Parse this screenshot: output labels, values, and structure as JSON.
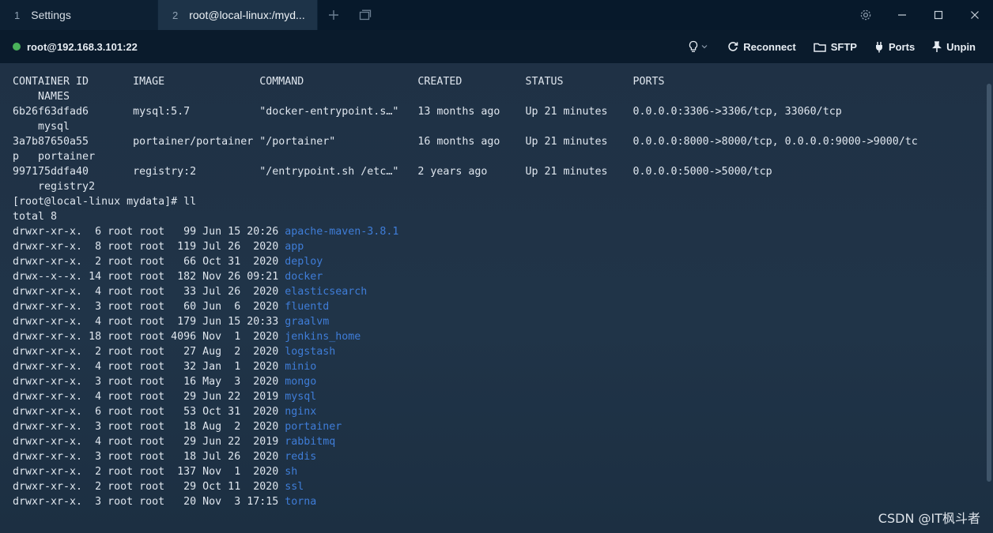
{
  "tabs": [
    {
      "number": "1",
      "title": "Settings"
    },
    {
      "number": "2",
      "title": "root@local-linux:/myd..."
    }
  ],
  "toolbar": {
    "host": "root@192.168.3.101:22",
    "reconnect_label": "Reconnect",
    "sftp_label": "SFTP",
    "ports_label": "Ports",
    "unpin_label": "Unpin"
  },
  "icons": {
    "new_tab": "plus-icon",
    "tab_layout": "tabs-layout-icon",
    "settings": "gear-icon",
    "minimize": "minimize-icon",
    "maximize": "maximize-icon",
    "close": "close-icon",
    "status": "status-dot",
    "bulb": "lightbulb-icon",
    "reconnect": "refresh-icon",
    "sftp": "folder-icon",
    "ports": "plug-icon",
    "unpin": "pin-icon"
  },
  "colors": {
    "status_connected": "#49b25a",
    "directory": "#3f7dd8",
    "text": "#dfe6ee"
  },
  "terminal": {
    "lines": [
      {
        "text": "CONTAINER ID       IMAGE               COMMAND                  CREATED          STATUS           PORTS"
      },
      {
        "text": "    NAMES"
      },
      {
        "text": "6b26f63dfad6       mysql:5.7           \"docker-entrypoint.s…\"   13 months ago    Up 21 minutes    0.0.0.0:3306->3306/tcp, 33060/tcp"
      },
      {
        "text": "    mysql"
      },
      {
        "text": "3a7b87650a55       portainer/portainer \"/portainer\"             16 months ago    Up 21 minutes    0.0.0.0:8000->8000/tcp, 0.0.0.0:9000->9000/tc"
      },
      {
        "text": "p   portainer"
      },
      {
        "text": "997175ddfa40       registry:2          \"/entrypoint.sh /etc…\"   2 years ago      Up 21 minutes    0.0.0.0:5000->5000/tcp"
      },
      {
        "text": "    registry2"
      },
      {
        "text": "[root@local-linux mydata]# ll"
      },
      {
        "text": "total 8"
      },
      {
        "text": "drwxr-xr-x.  6 root root   99 Jun 15 20:26 ",
        "dir": "apache-maven-3.8.1"
      },
      {
        "text": "drwxr-xr-x.  8 root root  119 Jul 26  2020 ",
        "dir": "app"
      },
      {
        "text": "drwxr-xr-x.  2 root root   66 Oct 31  2020 ",
        "dir": "deploy"
      },
      {
        "text": "drwx--x--x. 14 root root  182 Nov 26 09:21 ",
        "dir": "docker"
      },
      {
        "text": "drwxr-xr-x.  4 root root   33 Jul 26  2020 ",
        "dir": "elasticsearch"
      },
      {
        "text": "drwxr-xr-x.  3 root root   60 Jun  6  2020 ",
        "dir": "fluentd"
      },
      {
        "text": "drwxr-xr-x.  4 root root  179 Jun 15 20:33 ",
        "dir": "graalvm"
      },
      {
        "text": "drwxr-xr-x. 18 root root 4096 Nov  1  2020 ",
        "dir": "jenkins_home"
      },
      {
        "text": "drwxr-xr-x.  2 root root   27 Aug  2  2020 ",
        "dir": "logstash"
      },
      {
        "text": "drwxr-xr-x.  4 root root   32 Jan  1  2020 ",
        "dir": "minio"
      },
      {
        "text": "drwxr-xr-x.  3 root root   16 May  3  2020 ",
        "dir": "mongo"
      },
      {
        "text": "drwxr-xr-x.  4 root root   29 Jun 22  2019 ",
        "dir": "mysql"
      },
      {
        "text": "drwxr-xr-x.  6 root root   53 Oct 31  2020 ",
        "dir": "nginx"
      },
      {
        "text": "drwxr-xr-x.  3 root root   18 Aug  2  2020 ",
        "dir": "portainer"
      },
      {
        "text": "drwxr-xr-x.  4 root root   29 Jun 22  2019 ",
        "dir": "rabbitmq"
      },
      {
        "text": "drwxr-xr-x.  3 root root   18 Jul 26  2020 ",
        "dir": "redis"
      },
      {
        "text": "drwxr-xr-x.  2 root root  137 Nov  1  2020 ",
        "dir": "sh"
      },
      {
        "text": "drwxr-xr-x.  2 root root   29 Oct 11  2020 ",
        "dir": "ssl"
      },
      {
        "text": "drwxr-xr-x.  3 root root   20 Nov  3 17:15 ",
        "dir": "torna"
      }
    ]
  },
  "watermark": "CSDN @IT枫斗者"
}
